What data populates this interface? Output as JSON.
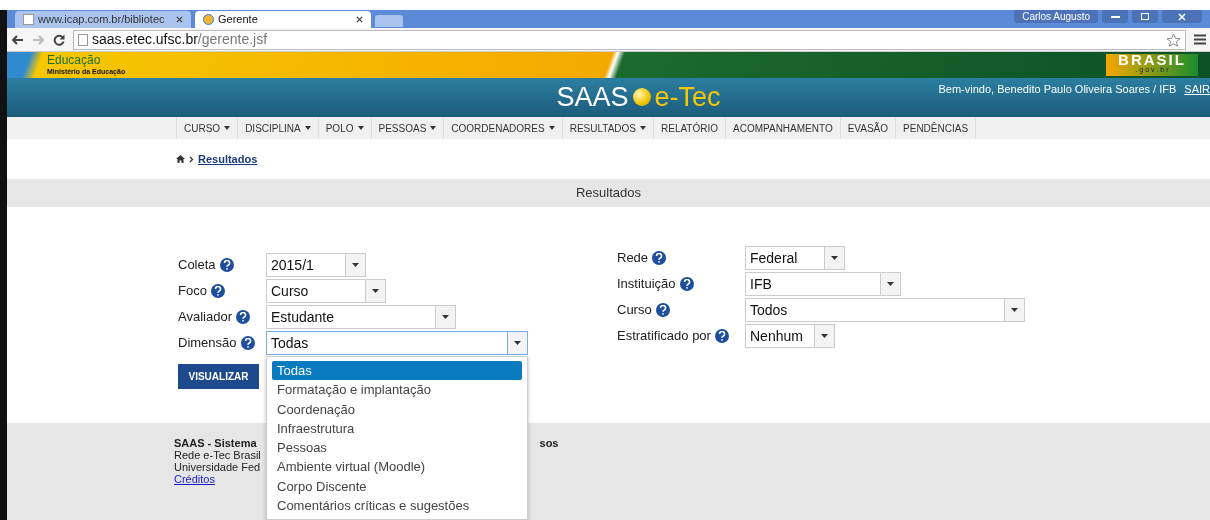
{
  "browser": {
    "tabs": [
      {
        "title": "www.icap.com.br/bibliotec",
        "selected": false
      },
      {
        "title": "Gerente",
        "selected": true
      }
    ],
    "user": "Carlos Augusto",
    "url_host": "saas.etec.ufsc.br",
    "url_path": "/gerente.jsf"
  },
  "gov_bar": {
    "title": "Educação",
    "subtitle": "Ministério da Educação",
    "brand": "BRASIL",
    "brand_sub": ". g o v . b r"
  },
  "header": {
    "logo_left": "SAAS",
    "logo_right": "e-Tec",
    "welcome": "Bem-vindo, Benedito Paulo Oliveira Soares / IFB",
    "logout": "SAIR"
  },
  "nav": [
    {
      "label": "CURSO",
      "menu": true
    },
    {
      "label": "DISCIPLINA",
      "menu": true
    },
    {
      "label": "POLO",
      "menu": true
    },
    {
      "label": "PESSOAS",
      "menu": true
    },
    {
      "label": "COORDENADORES",
      "menu": true
    },
    {
      "label": "RESULTADOS",
      "menu": true
    },
    {
      "label": "RELATÓRIO",
      "menu": false
    },
    {
      "label": "ACOMPANHAMENTO",
      "menu": false
    },
    {
      "label": "EVASÃO",
      "menu": false
    },
    {
      "label": "PENDÊNCIAS",
      "menu": false
    }
  ],
  "breadcrumb": "Resultados",
  "section_title": "Resultados",
  "left_fields": [
    {
      "label": "Coleta",
      "value": "2015/1",
      "open": false
    },
    {
      "label": "Foco",
      "value": "Curso",
      "open": false
    },
    {
      "label": "Avaliador",
      "value": "Estudante",
      "open": false
    },
    {
      "label": "Dimensão",
      "value": "Todas",
      "open": true
    }
  ],
  "right_fields": [
    {
      "label": "Rede",
      "value": "Federal",
      "open": false
    },
    {
      "label": "Instituição",
      "value": "IFB",
      "open": false
    },
    {
      "label": "Curso",
      "value": "Todos",
      "open": false
    },
    {
      "label": "Estratificado por",
      "value": "Nenhum",
      "open": false
    }
  ],
  "submit": "VISUALIZAR",
  "dropdown": [
    {
      "label": "Todas",
      "selected": true
    },
    {
      "label": "Formatação e implantação",
      "selected": false
    },
    {
      "label": "Coordenação",
      "selected": false
    },
    {
      "label": "Infraestrutura",
      "selected": false
    },
    {
      "label": "Pessoas",
      "selected": false
    },
    {
      "label": "Ambiente virtual (Moodle)",
      "selected": false
    },
    {
      "label": "Corpo Discente",
      "selected": false
    },
    {
      "label": "Comentários críticas e sugestões",
      "selected": false
    }
  ],
  "footer": {
    "title_start": "SAAS - Sistema",
    "title_end": "sos",
    "line_1": "Rede e-Tec Brasil",
    "line_2": "Universidade Fed",
    "link": "Créditos"
  }
}
